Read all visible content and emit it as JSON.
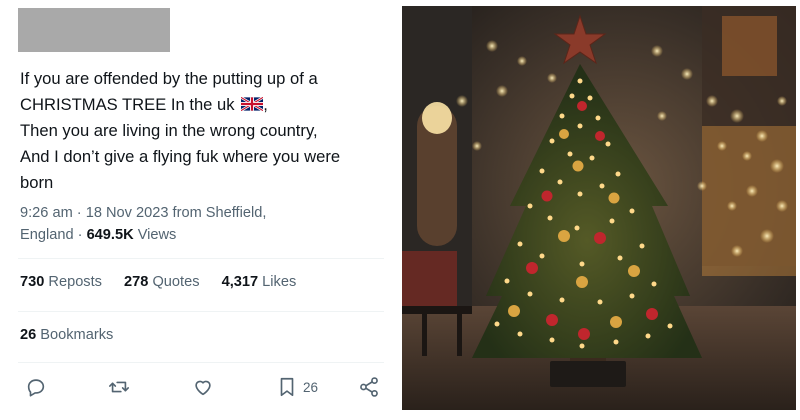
{
  "tweet": {
    "text_lines": [
      "If you are offended by the putting up of a",
      "CHRISTMAS TREE In the uk",
      "Then you are living in the wrong country,",
      "And I don’t give a flying fuk where you were",
      "born"
    ],
    "line2_suffix": ",",
    "flag_icon": "uk-flag-emoji",
    "meta": {
      "time": "9:26 am",
      "separator": "·",
      "date_source": "18 Nov 2023 from Sheffield,",
      "location_rest": "England",
      "views_count": "649.5K",
      "views_label": "Views"
    },
    "stats": [
      {
        "count": "730",
        "label": "Reposts"
      },
      {
        "count": "278",
        "label": "Quotes"
      },
      {
        "count": "4,317",
        "label": "Likes"
      }
    ],
    "bookmarks": {
      "count": "26",
      "label": "Bookmarks"
    },
    "actions": {
      "reply_icon": "reply-icon",
      "repost_icon": "repost-icon",
      "like_icon": "heart-icon",
      "bookmark_icon": "bookmark-icon",
      "bookmark_count": "26",
      "share_icon": "share-icon"
    }
  },
  "photo": {
    "subject": "christmas-tree-photo",
    "colors": {
      "tree": "#2f3d1e",
      "lights": "#ffd98a",
      "star": "#8a3a2a",
      "ornament_red": "#c0262d",
      "ornament_gold": "#d9a441"
    }
  }
}
